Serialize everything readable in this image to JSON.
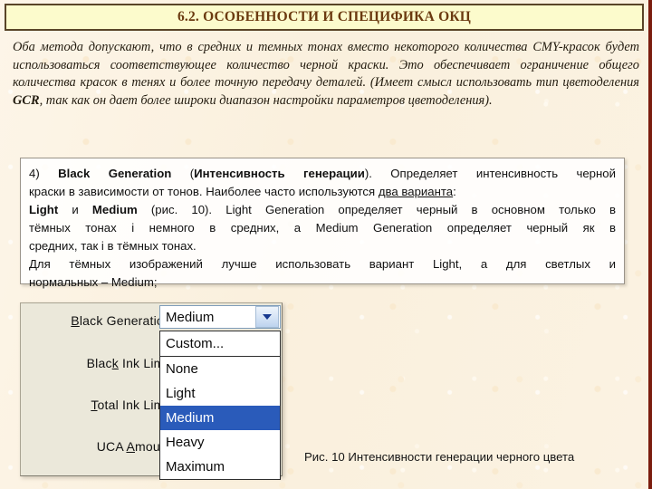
{
  "slide": {
    "title": "6.2. ОСОБЕННОСТИ И СПЕЦИФИКА ОКЦ",
    "accent_title_color": "#6b3a10",
    "title_bg_color": "#fcfbcc",
    "background_color": "#fcf2e2",
    "edge_strip_color": "#7b1d0f"
  },
  "intro": {
    "part1": "Оба метода допускают, что в средних и темных тонах вместо некоторого количества CMY-красок будет использоваться соответствующее количество черной краски. Это обеспечивает ограничение общего количества красок в тенях и более точную передачу деталей. (Имеет смысл использовать тип цветоделения ",
    "bold_term": "GCR",
    "part2": ", так как он дает более широки диапазон настройки параметров цветоделения)."
  },
  "description": {
    "item_number": "4)",
    "term_en": "Black Generation",
    "term_ru_open": " (",
    "term_ru": "Интенсивность генерации",
    "term_ru_close": "). ",
    "line1_tail": "Определяет интенсивность черной",
    "line2_a": "краски в зависимости от тонов. Наиболее часто используются ",
    "line2_underlined": "два варианта",
    "line2_b": ":",
    "line3_b1": "Light",
    "line3_mid": " и ",
    "line3_b2": "Medium",
    "line3_tail": " (рис. 10).   Light Generation определяет черный в основном только в",
    "line4": "тёмных тонах і немного в средних, а Medium Generation определяет черный як в",
    "line5": "средних, так і в тёмных тонах.",
    "line6": "Для тёмных изображений лучше использовать вариант Light, а для светлых и",
    "line7": "нормальных – Medium;"
  },
  "dialog": {
    "labels": {
      "black_generation": {
        "pre": "",
        "key": "B",
        "post": "lack Generation:"
      },
      "black_ink_limit": {
        "pre": "Blac",
        "key": "k",
        "post": " Ink Limit:"
      },
      "total_ink_limit": {
        "pre": "",
        "key": "T",
        "post": "otal Ink Limit:"
      },
      "uca_amount": {
        "pre": "UCA ",
        "key": "A",
        "post": "mount:"
      }
    },
    "combo": {
      "value": "Medium",
      "chevron_color": "#16388e",
      "button_color": "#c8dcf2"
    },
    "dropdown": {
      "highlight_color": "#2a5bba",
      "items": [
        {
          "label": "Custom...",
          "selected": false,
          "separator_after": true
        },
        {
          "label": "None",
          "selected": false,
          "separator_after": false
        },
        {
          "label": "Light",
          "selected": false,
          "separator_after": false
        },
        {
          "label": "Medium",
          "selected": true,
          "separator_after": false
        },
        {
          "label": "Heavy",
          "selected": false,
          "separator_after": false
        },
        {
          "label": "Maximum",
          "selected": false,
          "separator_after": false
        }
      ]
    }
  },
  "figure": {
    "caption": "Рис. 10 Интенсивности генерации черного цвета"
  }
}
